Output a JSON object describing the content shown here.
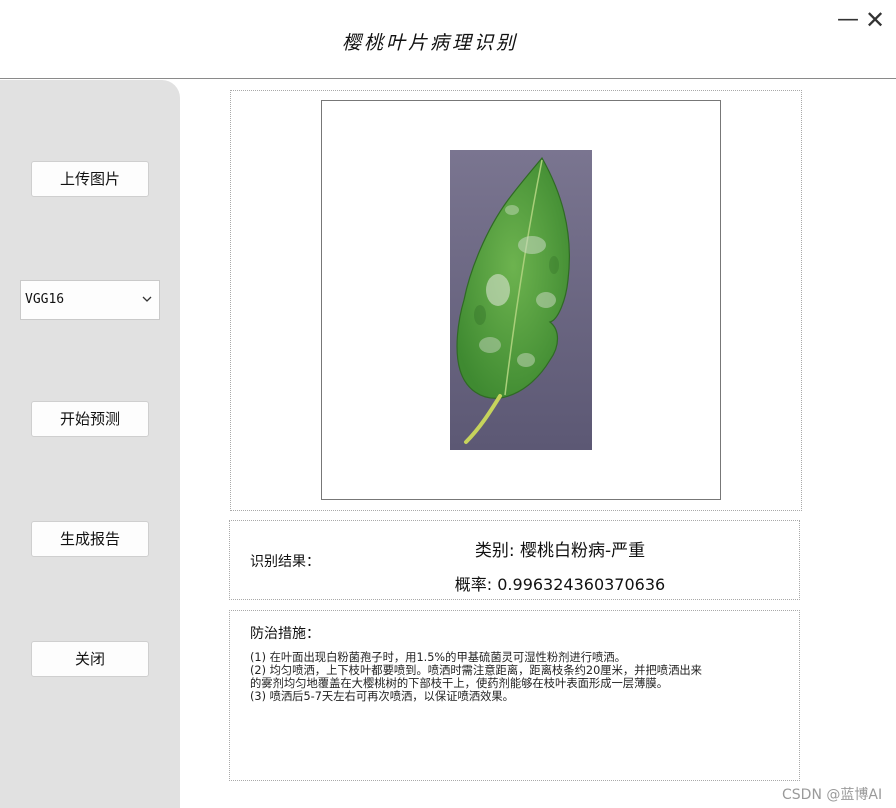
{
  "window": {
    "title": "樱桃叶片病理识别",
    "minimize_glyph": "—",
    "close_glyph": "✕"
  },
  "sidebar": {
    "upload_label": "上传图片",
    "model_select": {
      "selected": "VGG16",
      "icon": "chevron-down-icon"
    },
    "predict_label": "开始预测",
    "report_label": "生成报告",
    "close_label": "关闭"
  },
  "image_panel": {
    "image_subject": "cherry leaf with powdery mildew"
  },
  "result": {
    "label": "识别结果：",
    "category": "类别: 樱桃白粉病-严重",
    "probability": "概率: 0.996324360370636"
  },
  "measures": {
    "title": "防治措施：",
    "lines": [
      "(1) 在叶面出现白粉菌孢子时，用1.5%的甲基硫菌灵可湿性粉剂进行喷洒。",
      "(2) 均匀喷洒，上下枝叶都要喷到。喷洒时需注意距离，距离枝条约20厘米，并把喷洒出来",
      "的雾剂均匀地覆盖在大樱桃树的下部枝干上，使药剂能够在枝叶表面形成一层薄膜。",
      "(3) 喷洒后5-7天左右可再次喷洒，以保证喷洒效果。"
    ]
  },
  "watermark": "CSDN @蓝博AI",
  "colors": {
    "sidebar_bg": "#e1e1e1",
    "leaf_green": "#4f9a3a",
    "photo_bg": "#6f6a85"
  }
}
